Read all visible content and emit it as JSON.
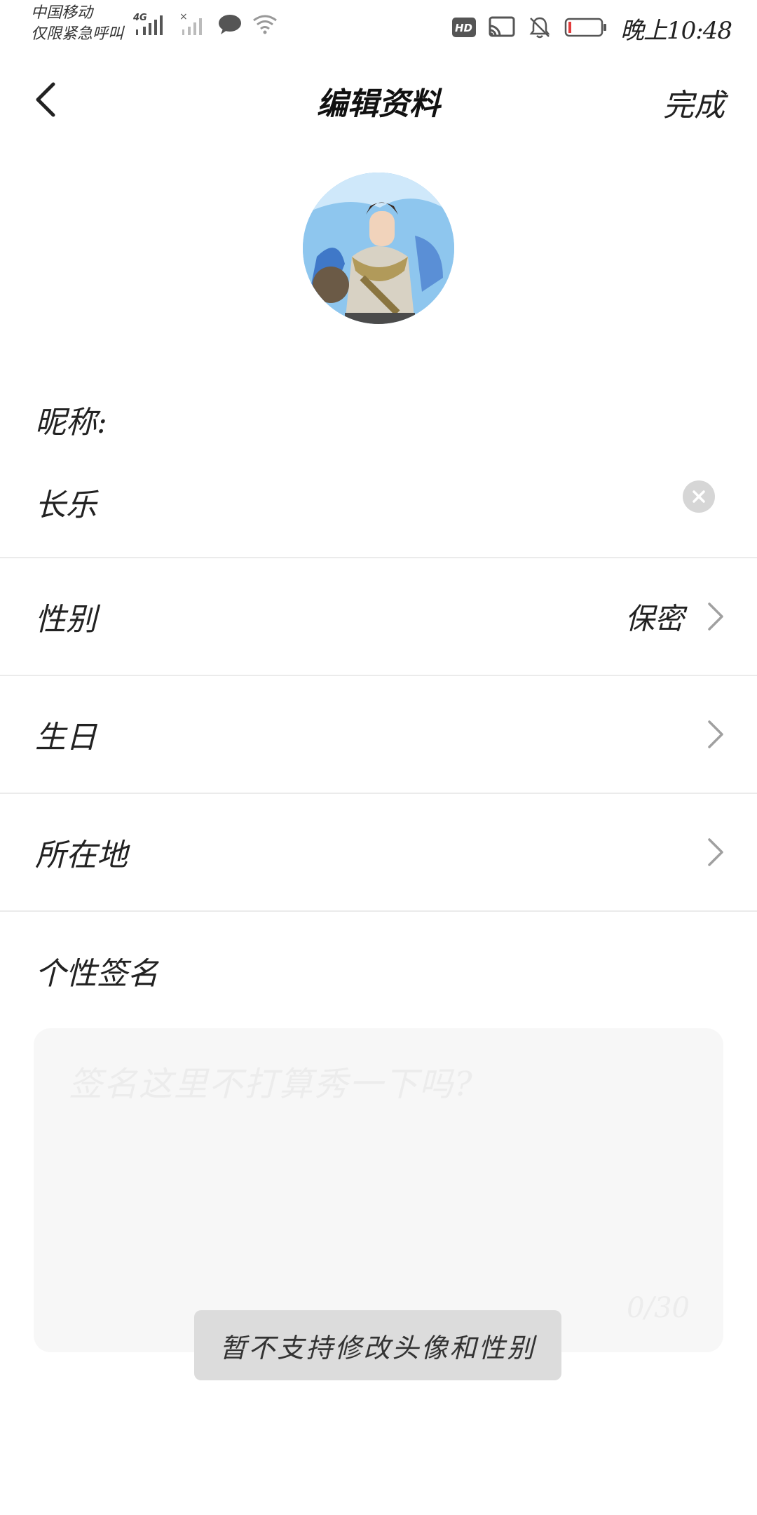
{
  "status_bar": {
    "carrier_line1": "中国移动",
    "carrier_line2": "仅限紧急呼叫",
    "network": "4G",
    "time": "晚上10:48",
    "icons": [
      "signal-icon",
      "no-signal-icon",
      "message-icon",
      "wifi-icon",
      "hd-icon",
      "cast-icon",
      "mute-icon",
      "battery-icon"
    ]
  },
  "header": {
    "title": "编辑资料",
    "done_label": "完成"
  },
  "profile": {
    "nickname_label": "昵称:",
    "nickname_value": "长乐",
    "rows": [
      {
        "label": "性别",
        "value": "保密"
      },
      {
        "label": "生日",
        "value": ""
      },
      {
        "label": "所在地",
        "value": ""
      }
    ],
    "signature_label": "个性签名",
    "signature_placeholder": "签名这里不打算秀一下吗?",
    "signature_count": "0/30"
  },
  "toast": {
    "message": "暂不支持修改头像和性别"
  },
  "colors": {
    "background": "#ffffff",
    "divider": "#ebebeb",
    "toast_bg": "#dcdcdc",
    "input_bg": "#f7f7f7"
  }
}
